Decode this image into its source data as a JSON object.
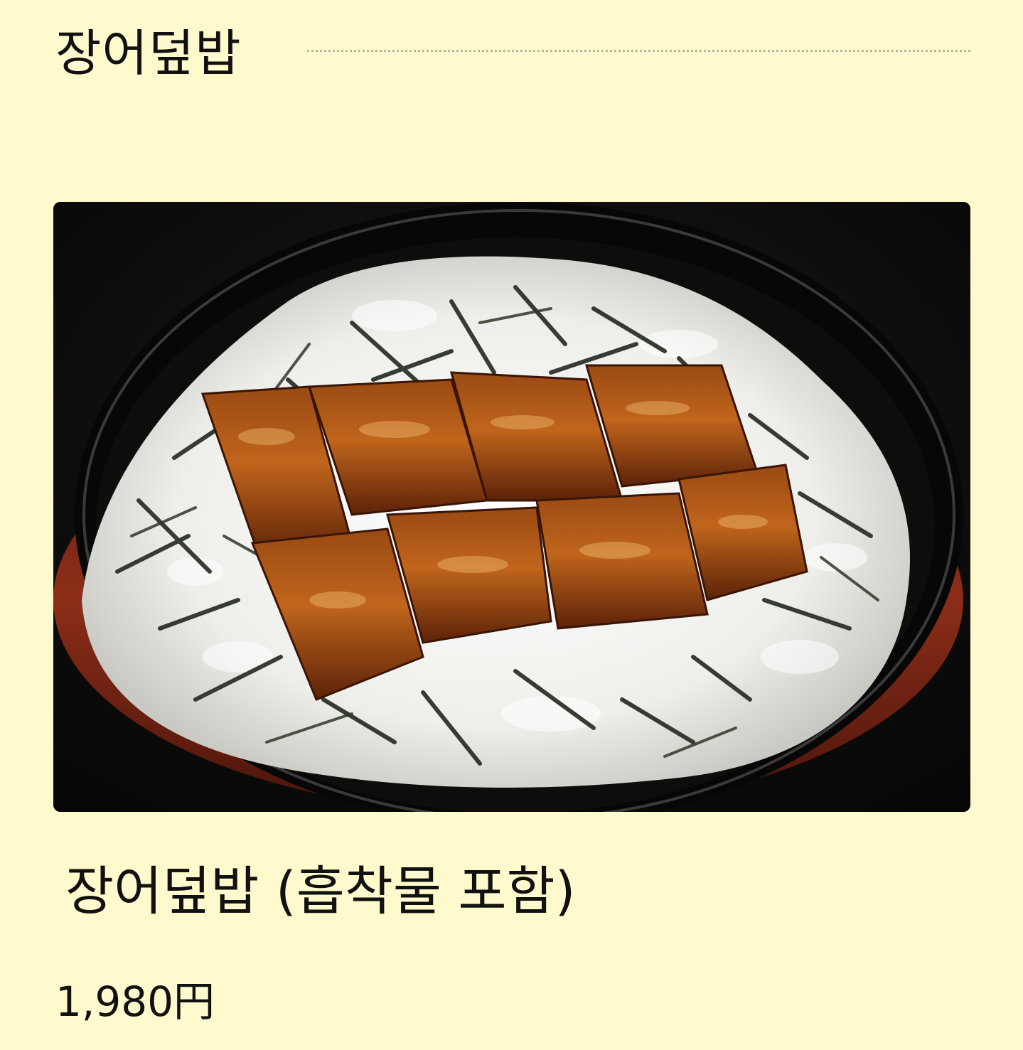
{
  "section": {
    "title": "장어덮밥"
  },
  "item": {
    "name": "장어덮밥 (흡착물 포함)",
    "price": "1,980円",
    "photo": "unagi-don-photo"
  },
  "colors": {
    "background": "#fefacd",
    "text": "#111111",
    "rule": "#b7b59e"
  }
}
